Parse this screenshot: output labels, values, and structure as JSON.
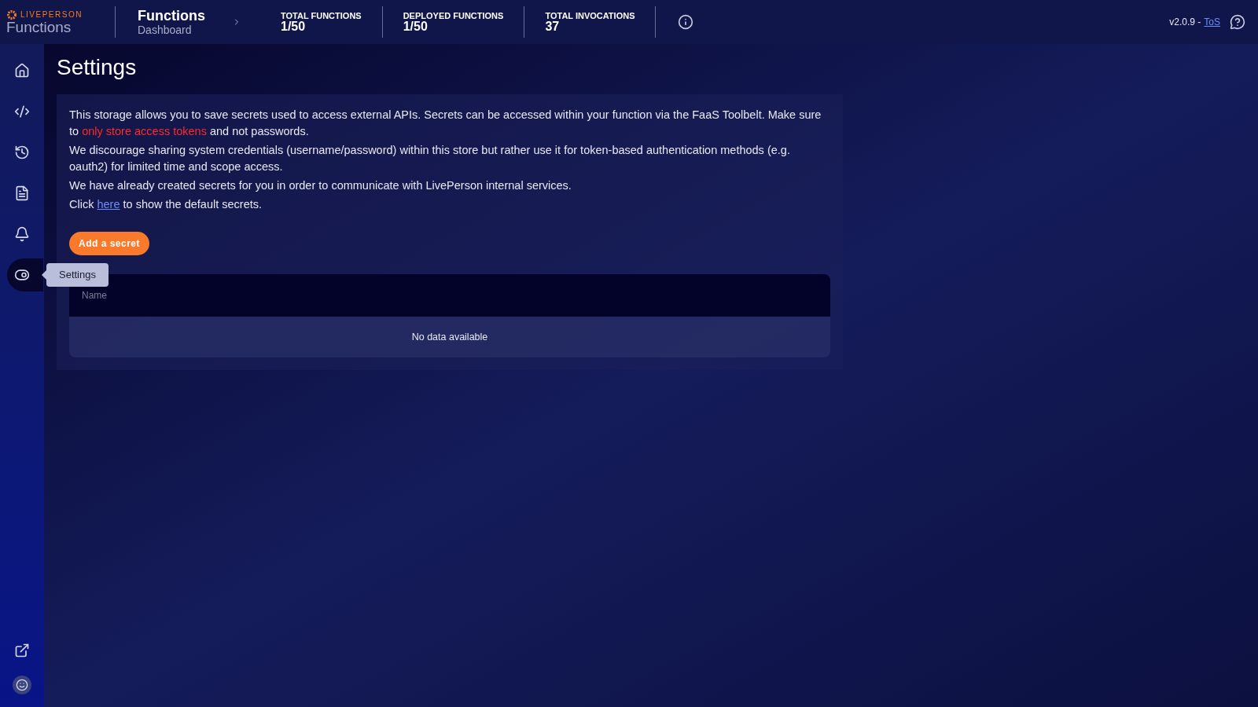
{
  "header": {
    "brand": "LIVEPERSON",
    "product": "Functions",
    "section": "Functions",
    "subsection": "Dashboard",
    "stats": [
      {
        "label": "TOTAL FUNCTIONS",
        "value": "1/50"
      },
      {
        "label": "DEPLOYED FUNCTIONS",
        "value": "1/50"
      },
      {
        "label": "TOTAL INVOCATIONS",
        "value": "37"
      }
    ],
    "version": "v2.0.9 -",
    "tos_link": "ToS"
  },
  "sidebar": {
    "items": [
      {
        "kind": "home",
        "selected": false
      },
      {
        "kind": "code",
        "selected": false
      },
      {
        "kind": "history",
        "selected": false
      },
      {
        "kind": "document",
        "selected": false
      },
      {
        "kind": "bell",
        "selected": false
      },
      {
        "kind": "settings",
        "selected": true
      }
    ],
    "tooltip": "Settings",
    "bottom_items": [
      {
        "kind": "external"
      },
      {
        "kind": "smiley"
      }
    ]
  },
  "page": {
    "title": "Settings",
    "paragraphs": [
      {
        "kind": "highlight",
        "before": "This storage allows you to save secrets used to access external APIs. Secrets can be accessed within your function via the FaaS Toolbelt. Make sure to ",
        "marked": "only store access tokens",
        "after": " and not passwords."
      },
      {
        "kind": "plain",
        "text": "We discourage sharing system credentials (username/password) within this store but rather use it for token-based authentication methods (e.g. oauth2) for limited time and scope access."
      },
      {
        "kind": "plain",
        "text": "We have already created secrets for you in order to communicate with LivePerson internal services."
      },
      {
        "kind": "link",
        "before": "Click ",
        "marked": "here",
        "after": " to show the default secrets."
      }
    ],
    "add_button": "Add a secret",
    "table": {
      "columns": [
        "Name"
      ],
      "empty_text": "No data available"
    }
  }
}
